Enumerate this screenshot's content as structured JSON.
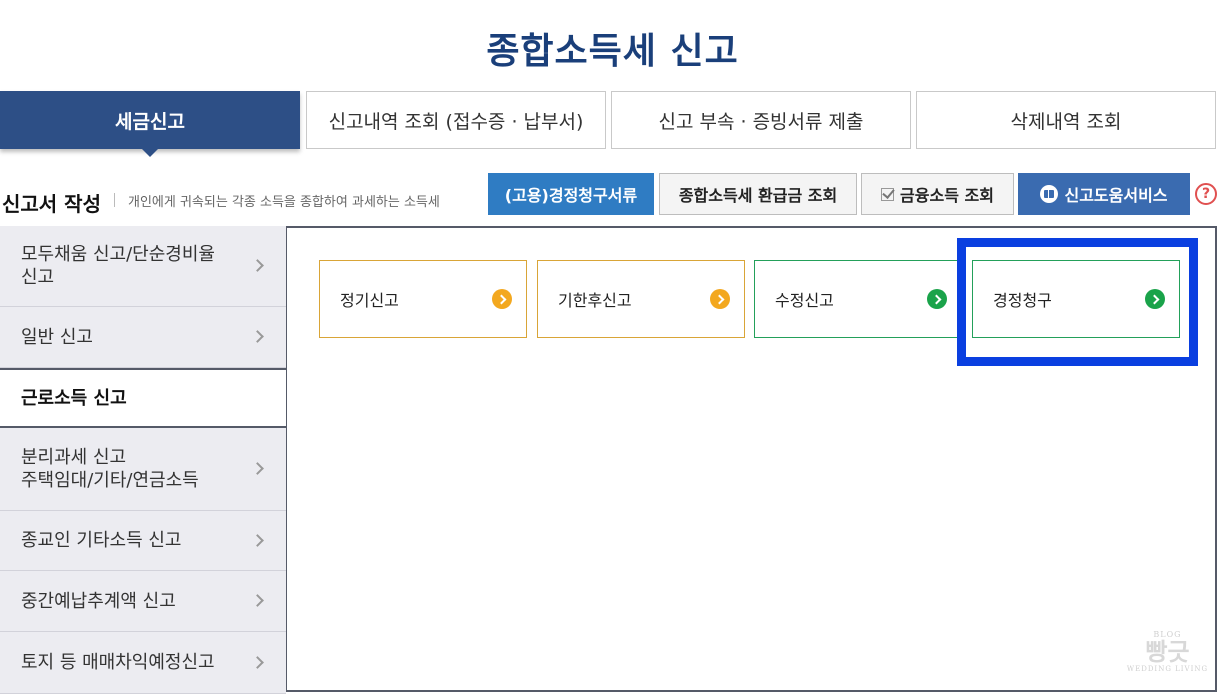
{
  "page": {
    "title": "종합소득세 신고"
  },
  "tabs": [
    {
      "label": "세금신고",
      "active": true
    },
    {
      "label": "신고내역 조회 (접수증 · 납부서)",
      "active": false
    },
    {
      "label": "신고 부속 · 증빙서류 제출",
      "active": false
    },
    {
      "label": "삭제내역 조회",
      "active": false
    }
  ],
  "section": {
    "title": "신고서 작성",
    "description": "개인에게 귀속되는 각종 소득을 종합하여 과세하는 소득세"
  },
  "actions": [
    {
      "label": "(고용)경정청구서류",
      "style": "blue"
    },
    {
      "label": "종합소득세 환급금 조회",
      "style": "gray"
    },
    {
      "label": "금융소득 조회",
      "style": "gray",
      "icon": "check-icon"
    },
    {
      "label": "신고도움서비스",
      "style": "navy",
      "icon": "book-icon"
    }
  ],
  "help": {
    "glyph": "?"
  },
  "sidebar": {
    "items": [
      {
        "label_line1": "모두채움 신고/단순경비율",
        "label_line2": "신고",
        "active": false
      },
      {
        "label_line1": "일반 신고",
        "label_line2": "",
        "active": false
      },
      {
        "label_line1": "근로소득 신고",
        "label_line2": "",
        "active": true
      },
      {
        "label_line1": "분리과세 신고",
        "label_line2": "주택임대/기타/연금소득",
        "active": false
      },
      {
        "label_line1": "종교인 기타소득 신고",
        "label_line2": "",
        "active": false
      },
      {
        "label_line1": "중간예납추계액 신고",
        "label_line2": "",
        "active": false
      },
      {
        "label_line1": "토지 등 매매차익예정신고",
        "label_line2": "",
        "active": false
      }
    ]
  },
  "cards": [
    {
      "label": "정기신고",
      "color": "#f3a81f"
    },
    {
      "label": "기한후신고",
      "color": "#f3a81f"
    },
    {
      "label": "수정신고",
      "color": "#1aa34a"
    },
    {
      "label": "경정청구",
      "color": "#1aa34a",
      "highlighted": true
    }
  ],
  "colors": {
    "accent": "#2d4f86",
    "highlight": "#0a3fe0"
  },
  "watermark": {
    "top": "BLOG",
    "main": "빵긋",
    "bottom": "WEDDING LIVING"
  }
}
